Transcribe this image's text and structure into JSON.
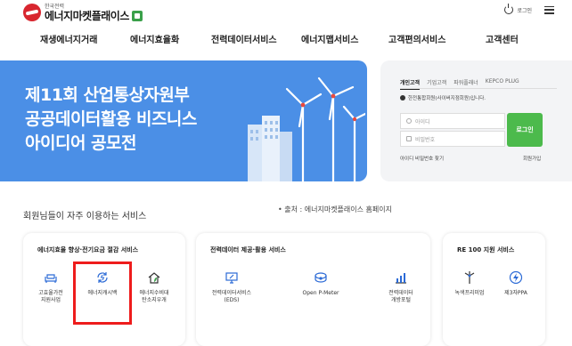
{
  "header": {
    "logo_small": "한국전력",
    "logo_big": "에너지마켓플래이스",
    "login_label": "로그인"
  },
  "nav": {
    "items": [
      "재생에너지거래",
      "에너지효율화",
      "전력데이터서비스",
      "에너지맵서비스",
      "고객편의서비스",
      "고객센터"
    ]
  },
  "hero": {
    "title_lines": [
      "제11회 산업통상자원부",
      "공공데이터활용 비즈니스",
      "아이디어 공모전"
    ]
  },
  "login": {
    "tabs": [
      "개인고객",
      "기업고객",
      "파워플래너",
      "KEPCO PLUG"
    ],
    "note": "한전통합회원(사이버지점회원)입니다.",
    "id_placeholder": "아이디",
    "pw_placeholder": "비밀번호",
    "button": "로그인",
    "find": "아이디 비밀번호 찾기",
    "signup": "회원가입"
  },
  "services": {
    "title": "회원님들이 자주 이용하는 서비스",
    "source": "• 출처 : 에너지마켓플래이스 홈페이지",
    "cards": [
      {
        "title": "에너지효율 향상·전기요금 절감 서비스",
        "items": [
          {
            "label": "고효율가전\n지원사업",
            "icon": "sofa-icon"
          },
          {
            "label": "에너지캐시백",
            "icon": "cashback-icon"
          },
          {
            "label": "에너지수비대\n탄소지우개",
            "icon": "house-leaf-icon"
          }
        ]
      },
      {
        "title": "전력데이터 제공·활용 서비스",
        "items": [
          {
            "label": "전력데이터서비스\n(EDS)",
            "icon": "monitor-pen-icon"
          },
          {
            "label": "Open P-Meter",
            "icon": "meter-icon"
          },
          {
            "label": "전력데이터\n개방포털",
            "icon": "bar-chart-icon"
          }
        ]
      },
      {
        "title": "RE 100 지원 서비스",
        "items": [
          {
            "label": "녹색프리미엄",
            "icon": "wind-turbine-icon"
          },
          {
            "label": "제3자PPA",
            "icon": "lightning-icon"
          }
        ]
      }
    ]
  },
  "colors": {
    "hero_bg": "#4b8fe6",
    "login_btn": "#4cba4c",
    "icon_blue": "#2b6ad6",
    "highlight": "#ee1c1c"
  }
}
